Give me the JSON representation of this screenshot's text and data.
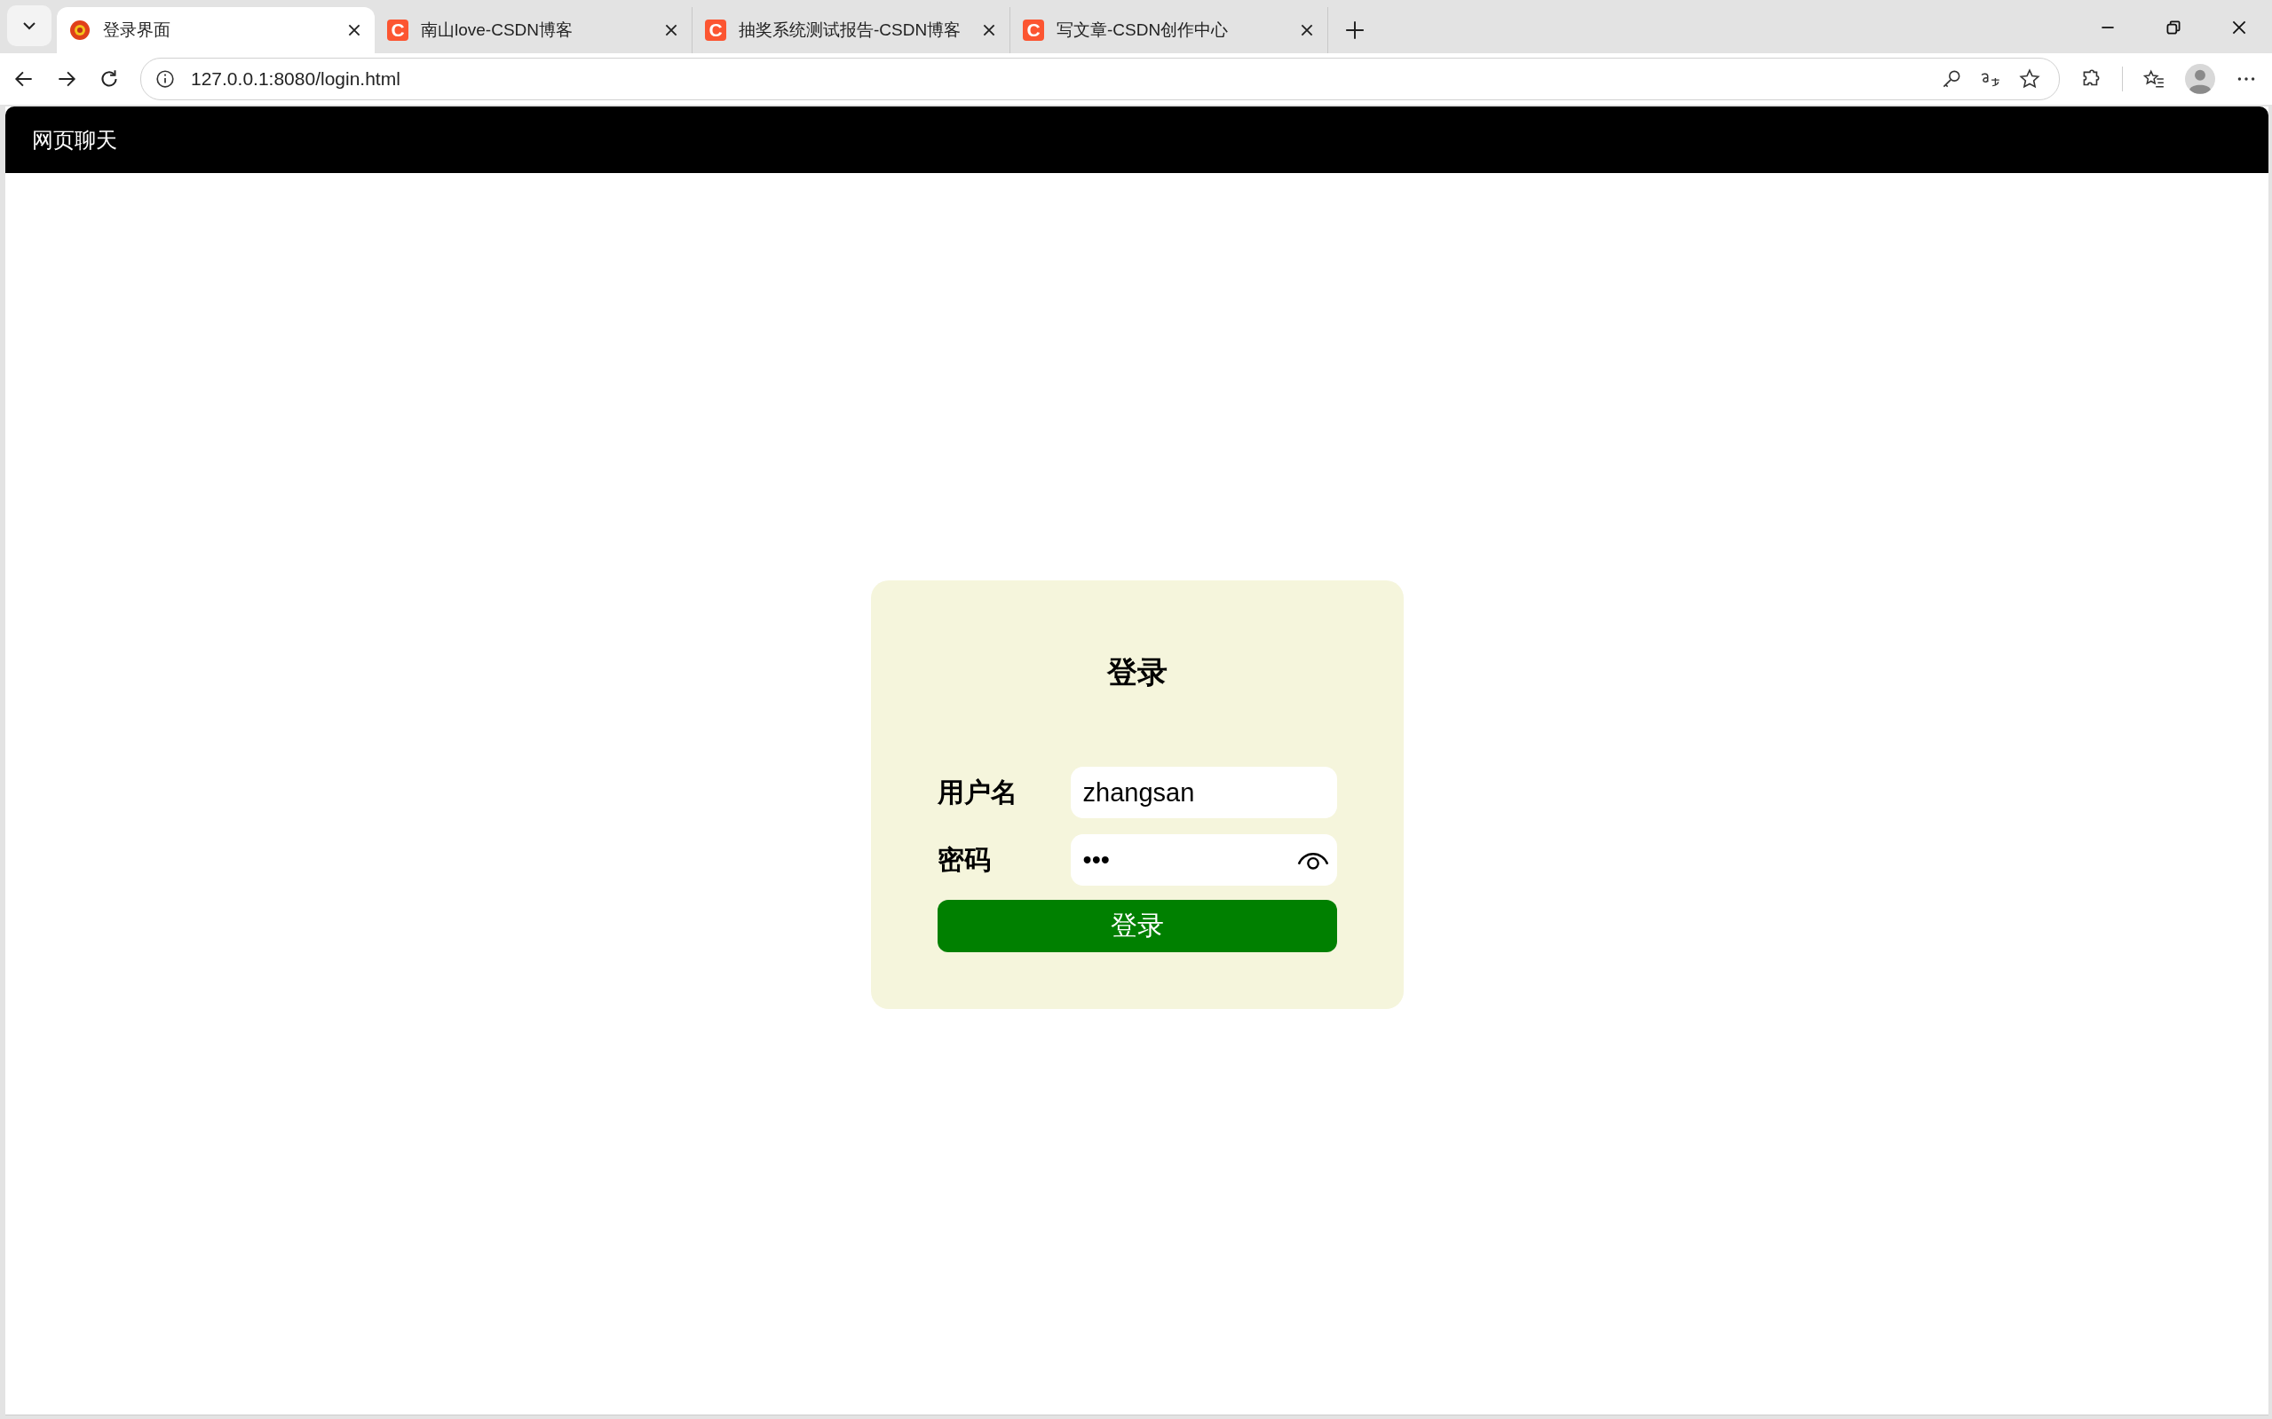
{
  "tabs": [
    {
      "title": "登录界面",
      "kind": "flower",
      "selected": true
    },
    {
      "title": "南山love-CSDN博客",
      "kind": "letter",
      "icon_letter": "C",
      "selected": false
    },
    {
      "title": "抽奖系统测试报告-CSDN博客",
      "kind": "letter",
      "icon_letter": "C",
      "selected": false
    },
    {
      "title": "写文章-CSDN创作中心",
      "kind": "letter",
      "icon_letter": "C",
      "selected": false
    }
  ],
  "address": "127.0.0.1:8080/login.html",
  "site_header": {
    "title": "网页聊天"
  },
  "login": {
    "title": "登录",
    "fields": [
      {
        "label": "用户名",
        "value": "zhangsan",
        "kind": "text"
      },
      {
        "label": "密码",
        "value": "•••",
        "kind": "password"
      }
    ],
    "button": "登录"
  }
}
